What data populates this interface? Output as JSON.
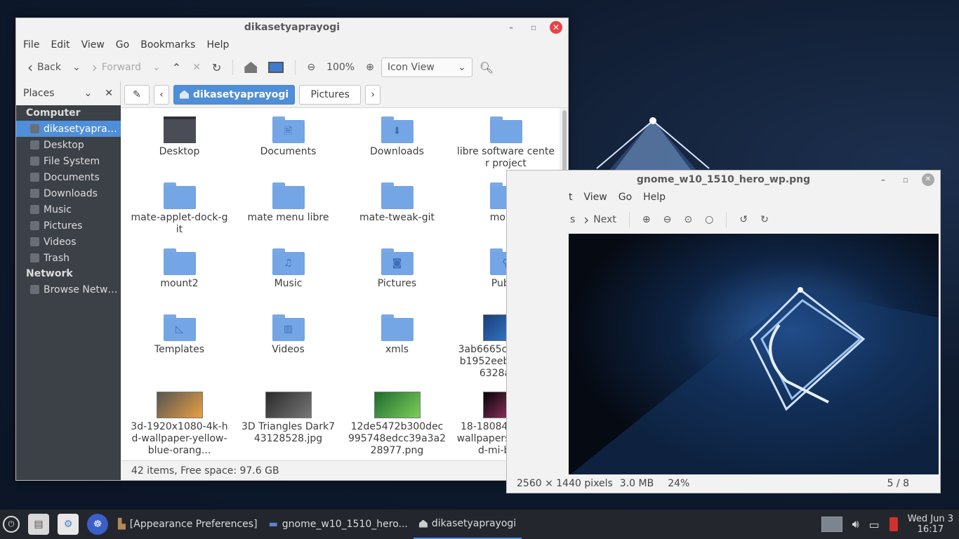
{
  "file_manager": {
    "title": "dikasetyaprayogi",
    "menu": [
      "File",
      "Edit",
      "View",
      "Go",
      "Bookmarks",
      "Help"
    ],
    "toolbar": {
      "back": "Back",
      "forward": "Forward",
      "zoom": "100%",
      "view_mode": "Icon View"
    },
    "sidebar": {
      "header": "Places",
      "computer_label": "Computer",
      "computer_items": [
        {
          "label": "dikasetyaprayogi",
          "icon": "home-icon"
        },
        {
          "label": "Desktop",
          "icon": "desktop-icon"
        },
        {
          "label": "File System",
          "icon": "drive-icon"
        },
        {
          "label": "Documents",
          "icon": "documents-icon"
        },
        {
          "label": "Downloads",
          "icon": "downloads-icon"
        },
        {
          "label": "Music",
          "icon": "music-icon"
        },
        {
          "label": "Pictures",
          "icon": "pictures-icon"
        },
        {
          "label": "Videos",
          "icon": "videos-icon"
        },
        {
          "label": "Trash",
          "icon": "trash-icon"
        }
      ],
      "network_label": "Network",
      "network_items": [
        {
          "label": "Browse Network",
          "icon": "network-icon"
        }
      ]
    },
    "path": {
      "current": "dikasetyaprayogi",
      "next": "Pictures"
    },
    "items": [
      {
        "name": "Desktop",
        "kind": "desktop"
      },
      {
        "name": "Documents",
        "kind": "folder",
        "glyph": "🗎"
      },
      {
        "name": "Downloads",
        "kind": "folder",
        "glyph": "⬇"
      },
      {
        "name": "libre software center project",
        "kind": "folder",
        "glyph": ""
      },
      {
        "name": "mate-applet-dock-git",
        "kind": "folder",
        "glyph": ""
      },
      {
        "name": "mate menu libre",
        "kind": "folder",
        "glyph": ""
      },
      {
        "name": "mate-tweak-git",
        "kind": "folder",
        "glyph": ""
      },
      {
        "name": "mount",
        "kind": "folder",
        "glyph": ""
      },
      {
        "name": "mount2",
        "kind": "folder",
        "glyph": ""
      },
      {
        "name": "Music",
        "kind": "folder",
        "glyph": "♫"
      },
      {
        "name": "Pictures",
        "kind": "folder",
        "glyph": "◙"
      },
      {
        "name": "Public",
        "kind": "folder",
        "glyph": "⚲"
      },
      {
        "name": "Templates",
        "kind": "folder",
        "glyph": "◺"
      },
      {
        "name": "Videos",
        "kind": "folder",
        "glyph": "▥"
      },
      {
        "name": "xmls",
        "kind": "folder",
        "glyph": ""
      },
      {
        "name": "3ab6665c6cd29f53b1952eeb3c86a506328a.png",
        "kind": "image",
        "colors": [
          "#1a3d7a",
          "#3a8ee0"
        ]
      },
      {
        "name": "3d-1920x1080-4k-hd-wallpaper-yellow-blue-orang...",
        "kind": "image",
        "colors": [
          "#555",
          "#e8a040"
        ]
      },
      {
        "name": "3D Triangles Dark743128528.jpg",
        "kind": "image",
        "colors": [
          "#2a2a2a",
          "#777"
        ]
      },
      {
        "name": "12de5472b300dec995748edcc39a3a228977.png",
        "kind": "image",
        "colors": [
          "#1f6b2e",
          "#7ccf5a"
        ]
      },
      {
        "name": "18-180844_3d-hd-wallpapers-download-mi-blac...",
        "kind": "image",
        "colors": [
          "#050505",
          "#c04080"
        ]
      }
    ],
    "status": "42 items, Free space: 97.6 GB"
  },
  "image_viewer": {
    "title": "gnome_w10_1510_hero_wp.png",
    "menu": [
      "t",
      "View",
      "Go",
      "Help"
    ],
    "toolbar": {
      "prev": "s",
      "next": "Next"
    },
    "status": {
      "dims": "2560 × 1440 pixels",
      "size": "3.0 MB",
      "zoom": "24%",
      "pos": "5 / 8"
    }
  },
  "panel": {
    "tasks": [
      "[Appearance Preferences]",
      "gnome_w10_1510_hero...",
      "dikasetyaprayogi"
    ],
    "clock": {
      "day": "Wed Jun  3",
      "time": "16:17"
    }
  }
}
